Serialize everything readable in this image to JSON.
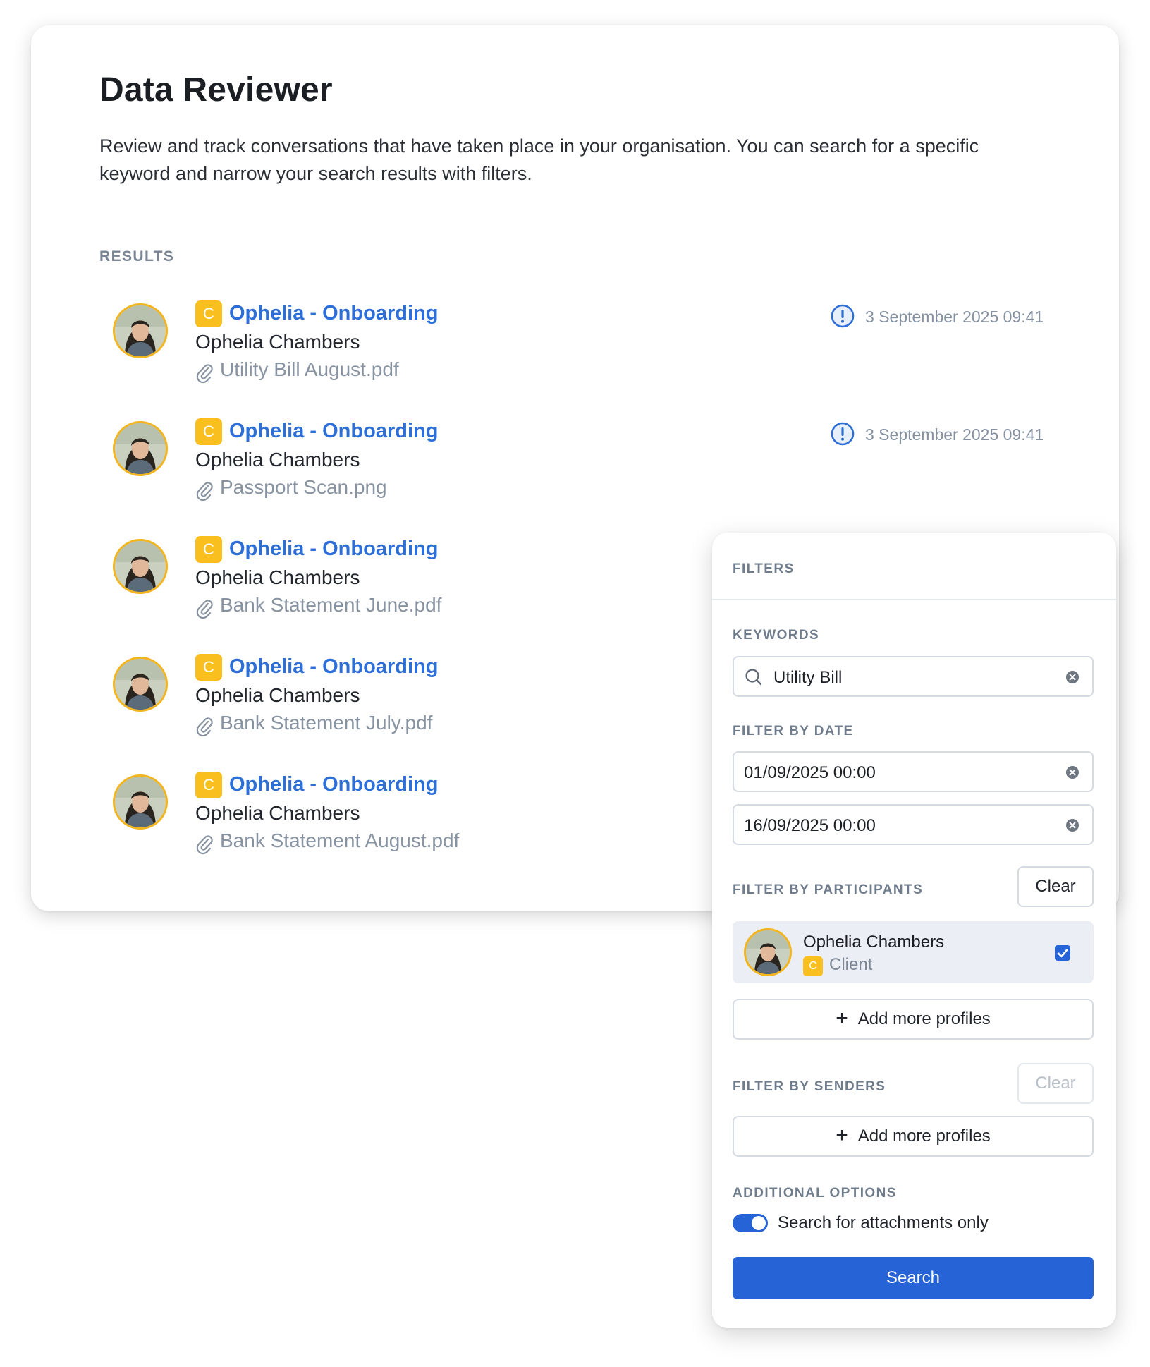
{
  "page": {
    "title": "Data Reviewer",
    "description": "Review and track conversations that have taken place in your organisation. You can search for a specific keyword and narrow your search results with filters."
  },
  "results": {
    "label": "RESULTS",
    "items": [
      {
        "badge": "C",
        "title": "Ophelia - Onboarding",
        "name": "Ophelia Chambers",
        "attachment": "Utility Bill August.pdf",
        "date": "3 September 2025 09:41",
        "alert_icon": "alert-circle-icon"
      },
      {
        "badge": "C",
        "title": "Ophelia - Onboarding",
        "name": "Ophelia Chambers",
        "attachment": "Passport Scan.png",
        "date": "3 September 2025 09:41",
        "alert_icon": "alert-circle-icon"
      },
      {
        "badge": "C",
        "title": "Ophelia - Onboarding",
        "name": "Ophelia Chambers",
        "attachment": "Bank Statement June.pdf"
      },
      {
        "badge": "C",
        "title": "Ophelia - Onboarding",
        "name": "Ophelia Chambers",
        "attachment": "Bank Statement July.pdf"
      },
      {
        "badge": "C",
        "title": "Ophelia - Onboarding",
        "name": "Ophelia Chambers",
        "attachment": "Bank Statement August.pdf"
      }
    ]
  },
  "filters": {
    "title": "FILTERS",
    "keywords": {
      "label": "KEYWORDS",
      "value": "Utility Bill"
    },
    "date": {
      "label": "FILTER BY DATE",
      "from": "01/09/2025 00:00",
      "to": "16/09/2025 00:00"
    },
    "participants": {
      "label": "FILTER BY PARTICIPANTS",
      "clear_label": "Clear",
      "items": [
        {
          "name": "Ophelia Chambers",
          "badge": "C",
          "role": "Client",
          "checked": true
        }
      ],
      "add_label": "Add more profiles"
    },
    "senders": {
      "label": "FILTER BY SENDERS",
      "clear_label": "Clear",
      "add_label": "Add more profiles"
    },
    "additional": {
      "label": "ADDITIONAL OPTIONS",
      "toggle_label": "Search for attachments only",
      "toggle_on": true
    },
    "search_label": "Search"
  },
  "colors": {
    "accent": "#2563d6",
    "link": "#2d6fd6",
    "badge": "#f9bf1e",
    "avatar_ring": "#f2b51f",
    "muted": "#8893a2"
  }
}
